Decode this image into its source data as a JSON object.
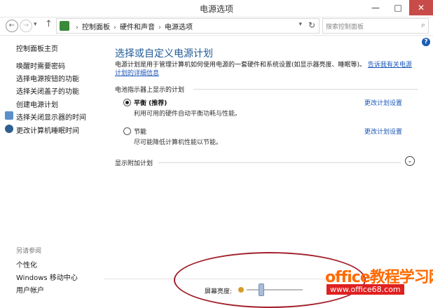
{
  "window": {
    "title": "电源选项",
    "min": "—",
    "max": "□",
    "close": "✕"
  },
  "nav": {
    "back": "←",
    "forward": "→",
    "dropdown": "▾",
    "up": "↑",
    "breadcrumbs": [
      "控制面板",
      "硬件和声音",
      "电源选项"
    ],
    "sep": "›",
    "refresh": "↻",
    "search_placeholder": "搜索控制面板",
    "search_icon": "⌕"
  },
  "sidebar": {
    "items": [
      {
        "label": "控制面板主页"
      },
      {
        "label": "唤醒时需要密码"
      },
      {
        "label": "选择电源按钮的功能"
      },
      {
        "label": "选择关闭盖子的功能"
      },
      {
        "label": "创建电源计划"
      },
      {
        "label": "选择关闭显示器的时间",
        "icon": "shield-icon"
      },
      {
        "label": "更改计算机睡眠时间",
        "icon": "moon-icon"
      }
    ],
    "see_also_title": "另请参阅",
    "see_also": [
      {
        "label": "个性化"
      },
      {
        "label": "Windows 移动中心"
      },
      {
        "label": "用户帐户"
      }
    ]
  },
  "main": {
    "heading": "选择或自定义电源计划",
    "description": "电源计划是用于管理计算机如何使用电源的一套硬件和系统设置(如显示器亮度、睡眠等)。",
    "description_link": "告诉我有关电源计划的详细信息",
    "group_battery": "电池指示器上显示的计划",
    "plans": [
      {
        "name": "平衡 (推荐)",
        "desc": "利用可用的硬件自动平衡功耗与性能。",
        "link": "更改计划设置",
        "selected": true
      },
      {
        "name": "节能",
        "desc": "尽可能降低计算机性能以节能。",
        "link": "更改计划设置",
        "selected": false
      }
    ],
    "group_additional": "显示附加计划",
    "expand_icon": "⌄",
    "help": "?"
  },
  "brightness": {
    "label": "屏幕亮度:",
    "level": 0.25
  },
  "watermark": {
    "brand": "office教程学习网",
    "url": "www.office68.com"
  }
}
